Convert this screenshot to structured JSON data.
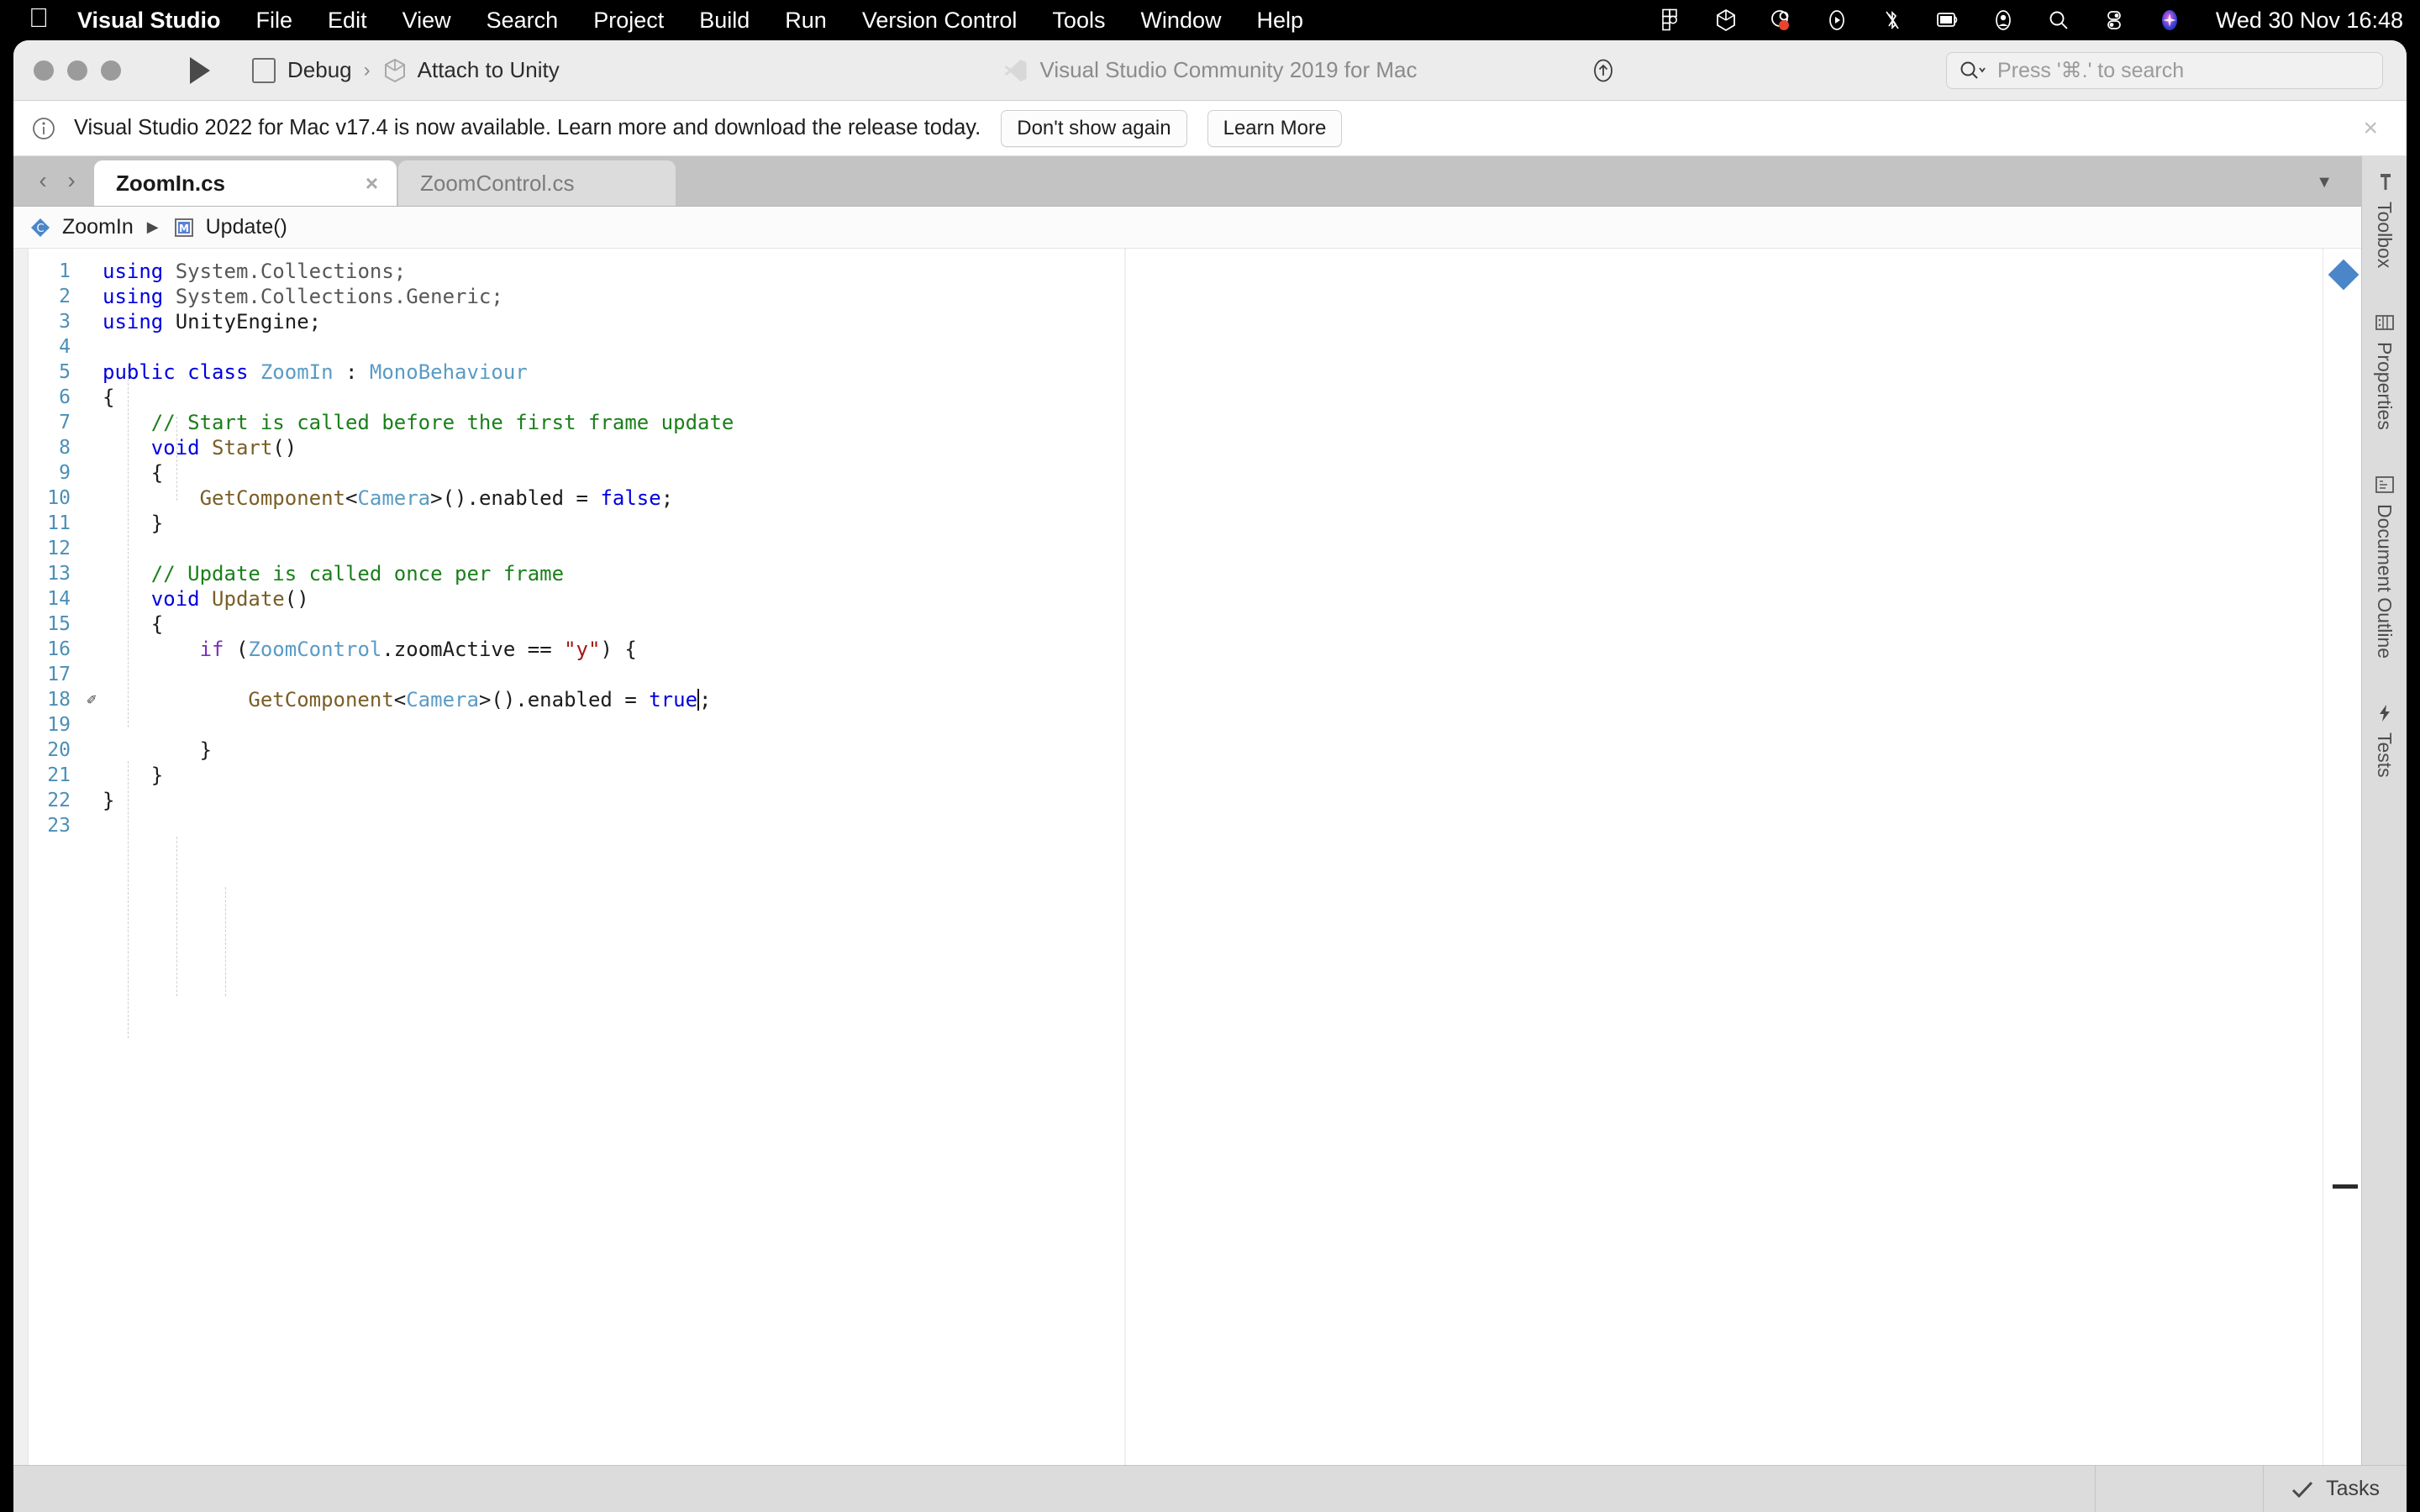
{
  "menubar": {
    "apple": "apple-logo",
    "items": [
      {
        "label": "Visual Studio",
        "bold": true
      },
      {
        "label": "File",
        "bold": false
      },
      {
        "label": "Edit",
        "bold": false
      },
      {
        "label": "View",
        "bold": false
      },
      {
        "label": "Search",
        "bold": false
      },
      {
        "label": "Project",
        "bold": false
      },
      {
        "label": "Build",
        "bold": false
      },
      {
        "label": "Run",
        "bold": false
      },
      {
        "label": "Version Control",
        "bold": false
      },
      {
        "label": "Tools",
        "bold": false
      },
      {
        "label": "Window",
        "bold": false
      },
      {
        "label": "Help",
        "bold": false
      }
    ],
    "status_icons": [
      "figma-icon",
      "unity-icon",
      "flow-record-icon",
      "media-play-icon",
      "bluetooth-off-icon",
      "screen-mirroring-icon",
      "user-account-icon",
      "spotlight-search-icon",
      "control-center-icon",
      "siri-icon"
    ],
    "clock": "Wed 30 Nov  16:48"
  },
  "toolbar": {
    "run_button": "run-play-icon",
    "configuration": "Debug",
    "run_target": "Attach to Unity",
    "title": "Visual Studio Community 2019 for Mac",
    "upload_button": "upload-arrow-icon",
    "search_placeholder": "Press '⌘.' to search"
  },
  "banner": {
    "icon": "info-circle-icon",
    "message": "Visual Studio 2022 for Mac v17.4 is now available. Learn more and download the release today.",
    "dismiss_label": "Don't show again",
    "learn_more_label": "Learn More",
    "close_label": "×"
  },
  "tabs": {
    "back_arrow": "‹",
    "forward_arrow": "›",
    "items": [
      {
        "label": "ZoomIn.cs",
        "active": true,
        "close": "×"
      },
      {
        "label": "ZoomControl.cs",
        "active": false,
        "close": ""
      }
    ],
    "overflow_menu": "▼"
  },
  "breadcrumb": {
    "class_icon": "class-diamond-icon",
    "class_name": "ZoomIn",
    "separator": "▶",
    "member_icon": "method-m-icon",
    "member_name": "Update()"
  },
  "editor": {
    "filename": "ZoomIn.cs",
    "total_lines": 23,
    "caret_line": 18,
    "edit_marker_line": 18,
    "lines": [
      {
        "n": 1,
        "tokens": [
          {
            "t": "using",
            "c": "k"
          },
          {
            "t": " System.Collections;",
            "c": "dim"
          }
        ]
      },
      {
        "n": 2,
        "tokens": [
          {
            "t": "using",
            "c": "k"
          },
          {
            "t": " System.Collections.Generic;",
            "c": "dim"
          }
        ]
      },
      {
        "n": 3,
        "tokens": [
          {
            "t": "using",
            "c": "k"
          },
          {
            "t": " UnityEngine;",
            "c": "id"
          }
        ]
      },
      {
        "n": 4,
        "tokens": []
      },
      {
        "n": 5,
        "tokens": [
          {
            "t": "public class ",
            "c": "k"
          },
          {
            "t": "ZoomIn",
            "c": "t"
          },
          {
            "t": " : ",
            "c": "id"
          },
          {
            "t": "MonoBehaviour",
            "c": "t"
          }
        ]
      },
      {
        "n": 6,
        "tokens": [
          {
            "t": "{",
            "c": "id"
          }
        ]
      },
      {
        "n": 7,
        "tokens": [
          {
            "t": "    // Start is called before the first frame update",
            "c": "c"
          }
        ]
      },
      {
        "n": 8,
        "tokens": [
          {
            "t": "    ",
            "c": "id"
          },
          {
            "t": "void",
            "c": "k"
          },
          {
            "t": " ",
            "c": "id"
          },
          {
            "t": "Start",
            "c": "m"
          },
          {
            "t": "()",
            "c": "id"
          }
        ]
      },
      {
        "n": 9,
        "tokens": [
          {
            "t": "    {",
            "c": "id"
          }
        ]
      },
      {
        "n": 10,
        "tokens": [
          {
            "t": "        ",
            "c": "id"
          },
          {
            "t": "GetComponent",
            "c": "m"
          },
          {
            "t": "<",
            "c": "id"
          },
          {
            "t": "Camera",
            "c": "t"
          },
          {
            "t": ">().enabled = ",
            "c": "id"
          },
          {
            "t": "false",
            "c": "k"
          },
          {
            "t": ";",
            "c": "id"
          }
        ]
      },
      {
        "n": 11,
        "tokens": [
          {
            "t": "    }",
            "c": "id"
          }
        ]
      },
      {
        "n": 12,
        "tokens": []
      },
      {
        "n": 13,
        "tokens": [
          {
            "t": "    // Update is called once per frame",
            "c": "c"
          }
        ]
      },
      {
        "n": 14,
        "tokens": [
          {
            "t": "    ",
            "c": "id"
          },
          {
            "t": "void",
            "c": "k"
          },
          {
            "t": " ",
            "c": "id"
          },
          {
            "t": "Update",
            "c": "m"
          },
          {
            "t": "()",
            "c": "id"
          }
        ]
      },
      {
        "n": 15,
        "tokens": [
          {
            "t": "    {",
            "c": "id"
          }
        ]
      },
      {
        "n": 16,
        "tokens": [
          {
            "t": "        ",
            "c": "id"
          },
          {
            "t": "if",
            "c": "kp"
          },
          {
            "t": " (",
            "c": "id"
          },
          {
            "t": "ZoomControl",
            "c": "t"
          },
          {
            "t": ".zoomActive == ",
            "c": "id"
          },
          {
            "t": "\"y\"",
            "c": "s"
          },
          {
            "t": ") {",
            "c": "id"
          }
        ]
      },
      {
        "n": 17,
        "tokens": []
      },
      {
        "n": 18,
        "tokens": [
          {
            "t": "            ",
            "c": "id"
          },
          {
            "t": "GetComponent",
            "c": "m"
          },
          {
            "t": "<",
            "c": "id"
          },
          {
            "t": "Camera",
            "c": "t"
          },
          {
            "t": ">().enabled = ",
            "c": "id"
          },
          {
            "t": "true",
            "c": "k"
          },
          {
            "t": ";",
            "c": "id"
          }
        ]
      },
      {
        "n": 19,
        "tokens": []
      },
      {
        "n": 20,
        "tokens": [
          {
            "t": "        }",
            "c": "id"
          }
        ]
      },
      {
        "n": 21,
        "tokens": [
          {
            "t": "    }",
            "c": "id"
          }
        ]
      },
      {
        "n": 22,
        "tokens": [
          {
            "t": "}",
            "c": "id"
          }
        ]
      },
      {
        "n": 23,
        "tokens": []
      }
    ]
  },
  "right_dock": {
    "items": [
      {
        "label": "Toolbox",
        "icon": "toolbox-hammer-icon"
      },
      {
        "label": "Properties",
        "icon": "properties-grid-icon"
      },
      {
        "label": "Document Outline",
        "icon": "document-outline-icon"
      },
      {
        "label": "Tests",
        "icon": "tests-lightning-icon"
      }
    ]
  },
  "statusbar": {
    "tasks_label": "Tasks",
    "tasks_icon": "check-icon"
  },
  "colors": {
    "accent_blue": "#4a86c8",
    "keyword": "#0000e0",
    "type": "#5a9bc4",
    "method": "#795e26",
    "comment": "#1a7f1a",
    "string": "#a31515",
    "control_keyword": "#7b2fbe",
    "line_number": "#4a8fb8",
    "chrome": "#ececec",
    "tabbar": "#c3c3c3"
  }
}
